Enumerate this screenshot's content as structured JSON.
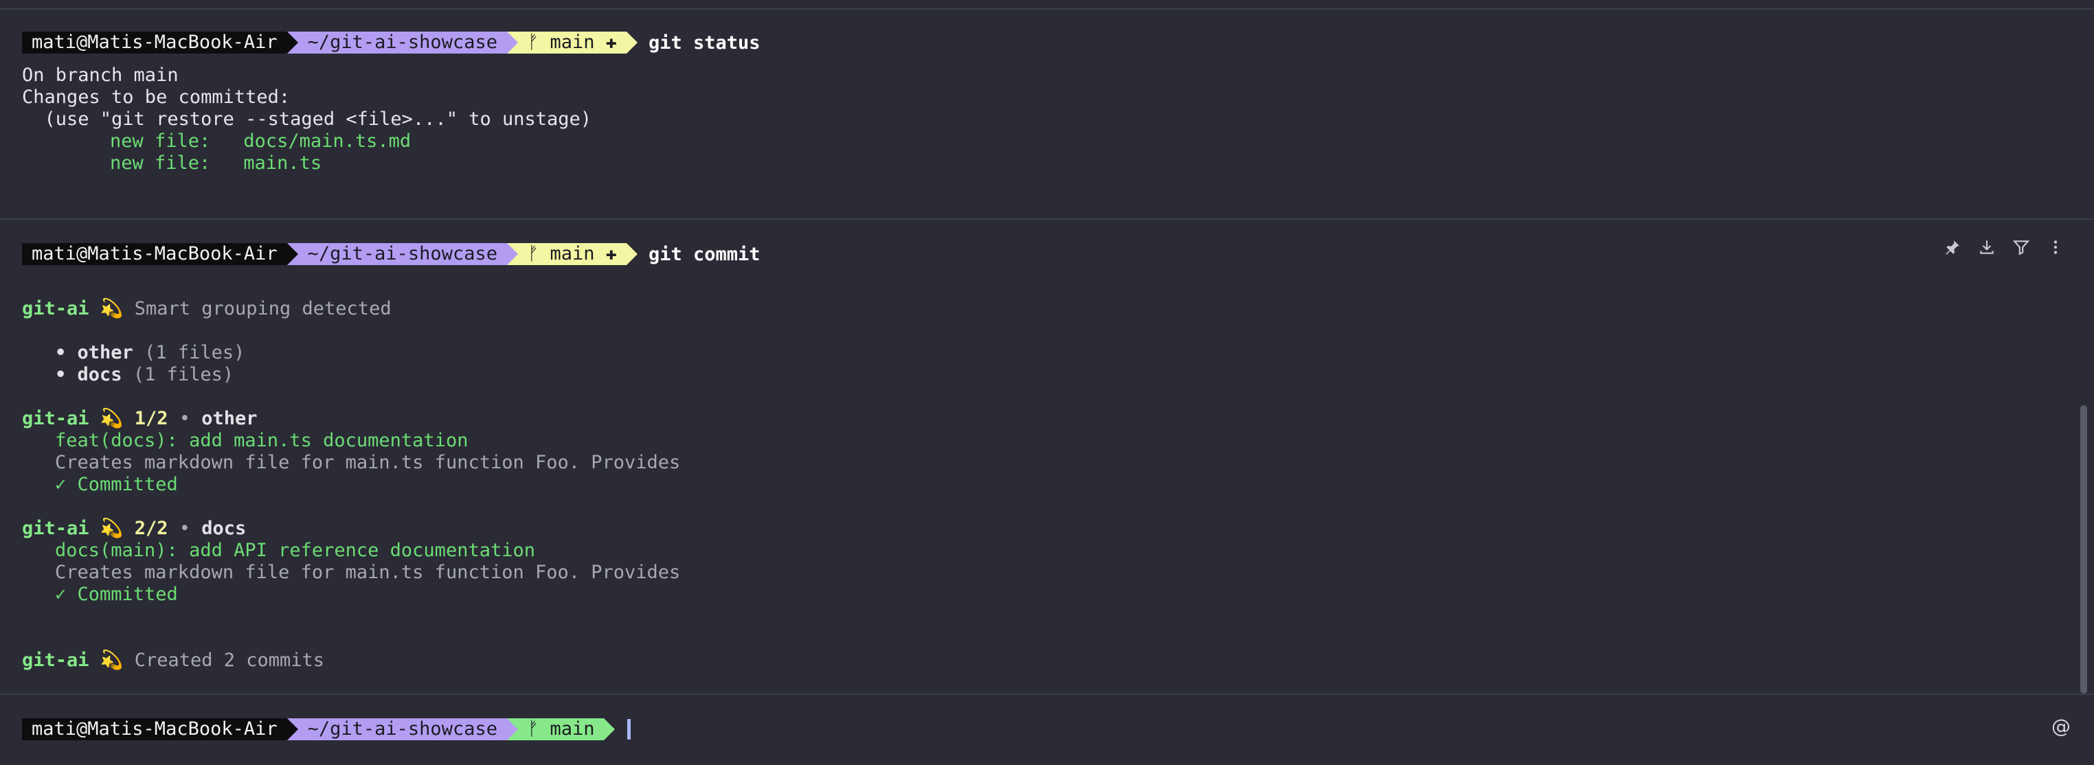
{
  "prompt": {
    "user": "mati@Matis-MacBook-Air",
    "dir": "~/git-ai-showcase",
    "branch_icon": "ᚠ",
    "branch": "main",
    "dirty_mark": "✚"
  },
  "block1": {
    "command": "git status",
    "lines": [
      "On branch main",
      "Changes to be committed:",
      "  (use \"git restore --staged <file>...\" to unstage)"
    ],
    "files": [
      {
        "status": "new file:",
        "path": "docs/main.ts.md"
      },
      {
        "status": "new file:",
        "path": "main.ts"
      }
    ]
  },
  "block2": {
    "command": "git commit",
    "tool": "git-ai",
    "emoji": "💫",
    "grouping_text": "Smart grouping detected",
    "groups": [
      {
        "bullet": "•",
        "name": "other",
        "count": "(1 files)"
      },
      {
        "bullet": "•",
        "name": "docs",
        "count": "(1 files)"
      }
    ],
    "commits": [
      {
        "index": "1/2",
        "sep": "•",
        "group": "other",
        "message": "feat(docs): add main.ts documentation",
        "body": "Creates markdown file for main.ts function Foo. Provides",
        "status": "✓ Committed"
      },
      {
        "index": "2/2",
        "sep": "•",
        "group": "docs",
        "message": "docs(main): add API reference documentation",
        "body": "Creates markdown file for main.ts function Foo. Provides",
        "status": "✓ Committed"
      }
    ],
    "summary": "Created 2 commits"
  },
  "toolbar": {
    "icons": [
      "pin-icon",
      "download-icon",
      "filter-icon",
      "more-icon"
    ]
  },
  "colors": {
    "background": "#2a2b35",
    "user_seg": "#0d0d0f",
    "dir_seg": "#b39df3",
    "git_dirty_seg": "#f3f6a2",
    "git_clean_seg": "#86e889",
    "accent_green": "#6cdc74"
  },
  "at_symbol": "@"
}
